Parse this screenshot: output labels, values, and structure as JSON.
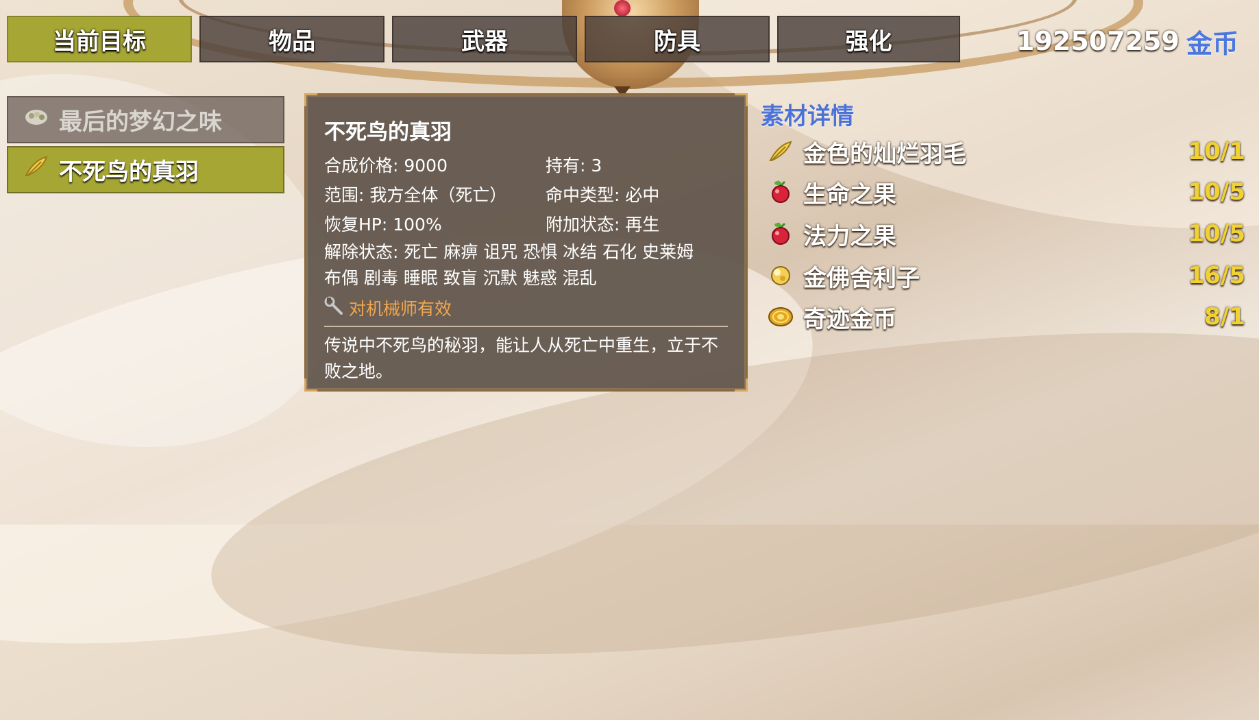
{
  "tabs": [
    {
      "label": "当前目标",
      "active": true
    },
    {
      "label": "物品",
      "active": false
    },
    {
      "label": "武器",
      "active": false
    },
    {
      "label": "防具",
      "active": false
    },
    {
      "label": "强化",
      "active": false
    }
  ],
  "currency": {
    "amount": "192507259",
    "unit": "金币"
  },
  "recipes": [
    {
      "name": "最后的梦幻之味",
      "icon": "bowl-icon",
      "active": false
    },
    {
      "name": "不死鸟的真羽",
      "icon": "feather-icon",
      "active": true
    }
  ],
  "detail": {
    "title": "不死鸟的真羽",
    "price": "合成价格: 9000",
    "owned": "持有: 3",
    "scope": "范围: 我方全体（死亡）",
    "hit_type": "命中类型: 必中",
    "recover": "恢复HP: 100%",
    "add_state": "附加状态: 再生",
    "clear_line1": "解除状态: 死亡 麻痹 诅咒 恐惧 冰结 石化 史莱姆",
    "clear_line2": "布偶 剧毒 睡眠 致盲 沉默 魅惑 混乱",
    "mechanic_note": "对机械师有效",
    "description": "传说中不死鸟的秘羽，能让人从死亡中重生，立于不败之地。"
  },
  "materials": {
    "header": "素材详情",
    "items": [
      {
        "name": "金色的灿烂羽毛",
        "count": "10/1",
        "icon": "gold-feather-icon"
      },
      {
        "name": "生命之果",
        "count": "10/5",
        "icon": "red-fruit-icon"
      },
      {
        "name": "法力之果",
        "count": "10/5",
        "icon": "red-fruit-icon"
      },
      {
        "name": "金佛舍利子",
        "count": "16/5",
        "icon": "gold-orb-icon"
      },
      {
        "name": "奇迹金币",
        "count": "8/1",
        "icon": "gold-coin-icon"
      }
    ]
  },
  "colors": {
    "tab_active": "#a6a635",
    "tab_inactive": "#4a403a",
    "material_header": "#4d72d6",
    "count_yellow": "#f2d230",
    "mechanic_orange": "#f1a64c"
  }
}
